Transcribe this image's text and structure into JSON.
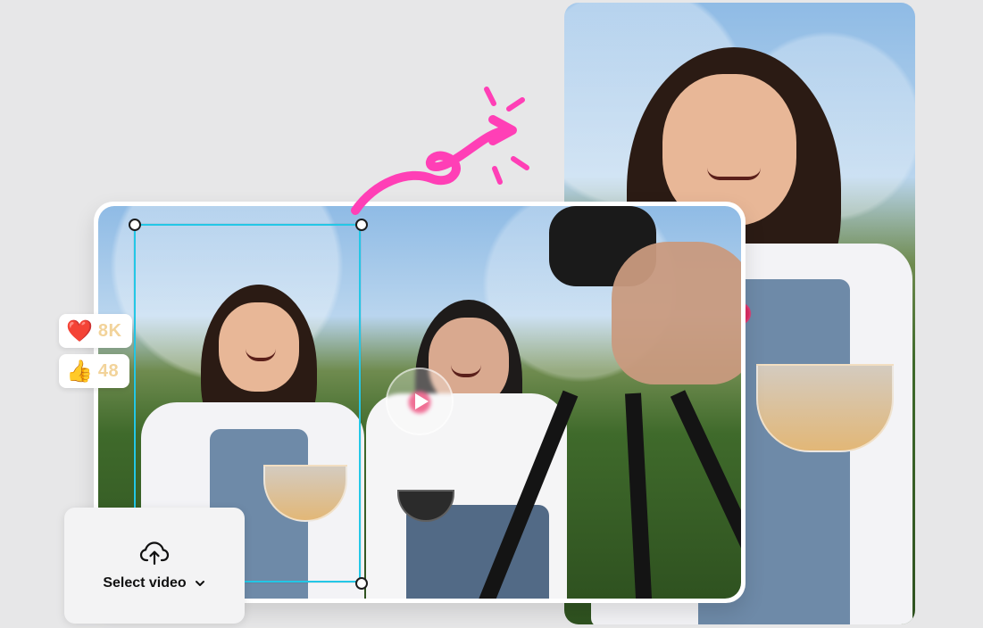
{
  "colors": {
    "accent": "#23c7e6",
    "arrow": "#ff3fb6",
    "reaction_count": "#f2d39a",
    "background": "#e7e7e8"
  },
  "reactions": [
    {
      "emoji": "❤️",
      "icon": "heart-icon",
      "count": "8K"
    },
    {
      "emoji": "👍",
      "icon": "thumbs-up-icon",
      "count": "48"
    }
  ],
  "select_video": {
    "label": "Select video",
    "icon": "cloud-upload-icon",
    "chevron": "chevron-down-icon"
  },
  "preview": {
    "play_icon": "play-icon"
  }
}
